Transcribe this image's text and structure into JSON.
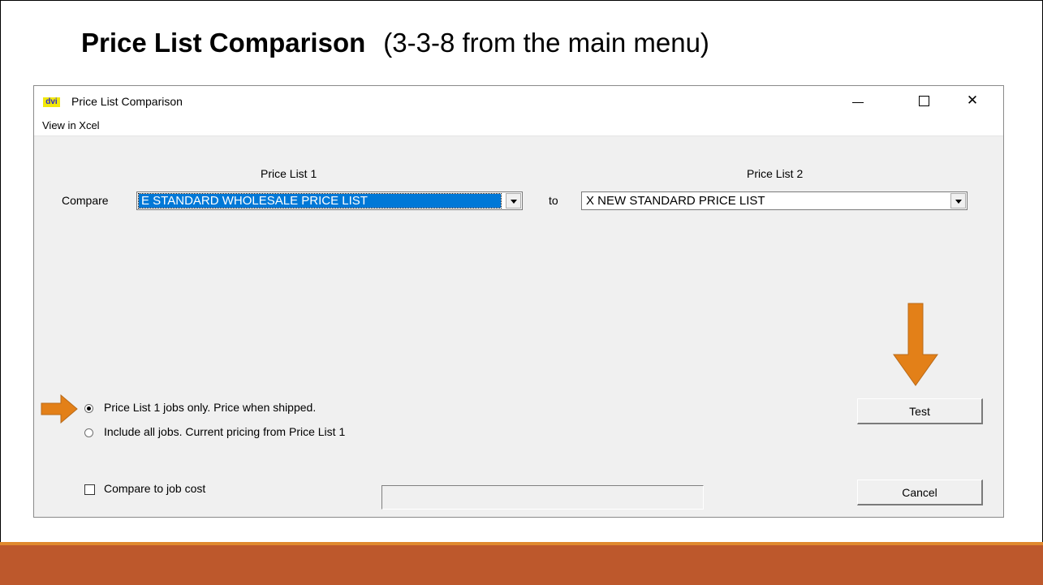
{
  "slide": {
    "title_bold": "Price List Comparison",
    "title_rest": "(3-3-8 from the main menu)"
  },
  "window": {
    "icon_text": "dvi",
    "title": "Price List Comparison",
    "menu": [
      "View in Xcel"
    ]
  },
  "form": {
    "price_list_1_label": "Price List 1",
    "price_list_2_label": "Price List 2",
    "compare_label": "Compare",
    "to_label": "to",
    "price_list_1_value": "E  STANDARD WHOLESALE PRICE LIST",
    "price_list_2_value": "X  NEW STANDARD PRICE LIST",
    "options": [
      {
        "label": "Price List 1 jobs only. Price when shipped.",
        "selected": true
      },
      {
        "label": "Include all jobs. Current pricing from Price List 1",
        "selected": false
      }
    ],
    "compare_job_cost_label": "Compare to job cost",
    "compare_job_cost_checked": false,
    "test_label": "Test",
    "cancel_label": "Cancel"
  },
  "colors": {
    "accent_bar": "#bd582c",
    "accent_line": "#e0892e",
    "arrow": "#e38018",
    "selection": "#0078d7"
  }
}
